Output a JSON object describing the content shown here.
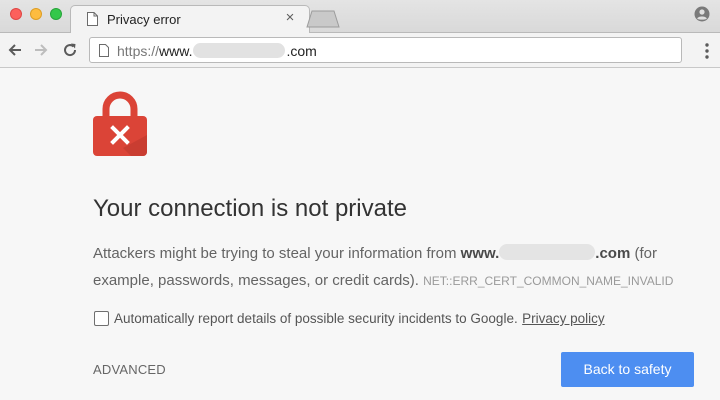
{
  "browser": {
    "tab": {
      "title": "Privacy error",
      "close_glyph": "×"
    },
    "address_bar": {
      "scheme": "https://",
      "host_prefix": "www.",
      "host_suffix": ".com"
    },
    "icons": {
      "back": "back-arrow-icon",
      "forward": "forward-arrow-icon",
      "reload": "reload-icon",
      "menu": "vertical-dots-menu-icon",
      "profile": "profile-icon",
      "page": "page-icon"
    }
  },
  "interstitial": {
    "heading": "Your connection is not private",
    "body_before_domain": "Attackers might be trying to steal your information from ",
    "domain_prefix": "www.",
    "domain_suffix": ".com",
    "body_after_domain": " (for example, passwords, messages, or credit cards).",
    "error_code": "NET::ERR_CERT_COMMON_NAME_INVALID",
    "report_label": "Automatically report details of possible security incidents to Google.",
    "privacy_link": "Privacy policy",
    "report_checked": false,
    "advanced_label": "ADVANCED",
    "back_button_label": "Back to safety"
  },
  "colors": {
    "lock_red": "#db4437",
    "primary_button": "#4d8ef1",
    "background": "#f7f7f7"
  }
}
